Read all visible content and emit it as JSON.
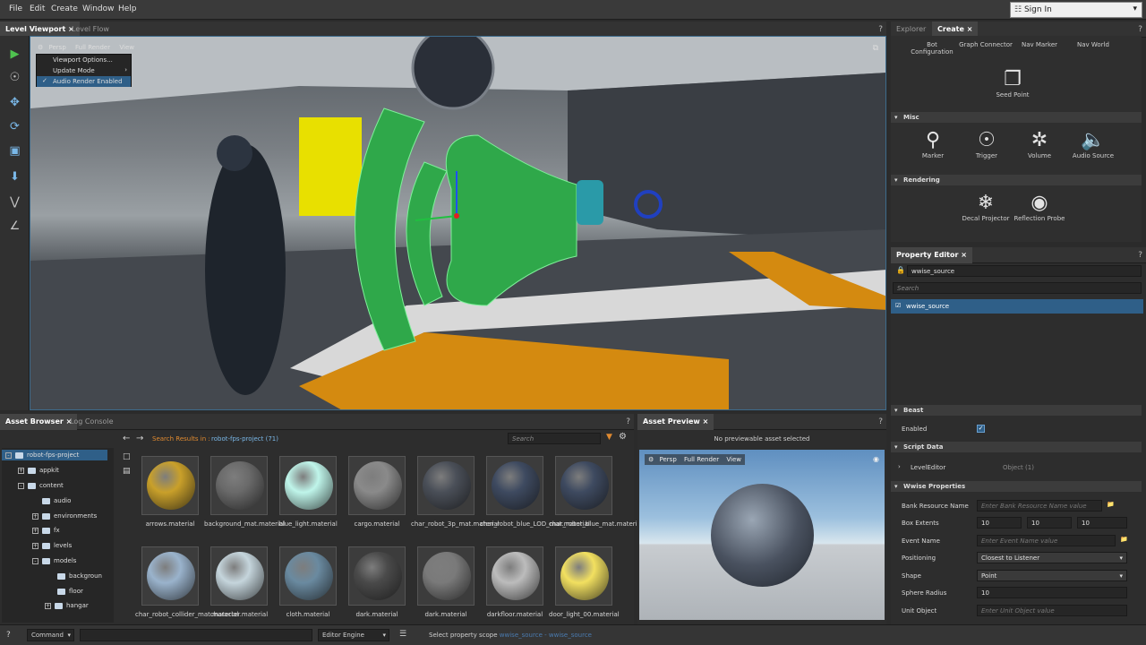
{
  "menu": [
    "File",
    "Edit",
    "Create",
    "Window",
    "Help"
  ],
  "signin": {
    "label": "Sign In"
  },
  "viewport_tabs": [
    "Level Viewport",
    "Level Flow"
  ],
  "viewport_toolbar": {
    "persp": "Persp",
    "render": "Full Render",
    "view": "View"
  },
  "viewport_menu": [
    "Viewport Options...",
    "Update Mode",
    "Audio Render Enabled"
  ],
  "right_tabs": [
    "Explorer",
    "Create"
  ],
  "create": {
    "top_items": [
      "Bot Configuration",
      "Graph Connector",
      "Nav Marker",
      "Nav World"
    ],
    "seed": "Seed Point",
    "misc_label": "Misc",
    "misc_items": [
      "Marker",
      "Trigger",
      "Volume",
      "Audio Source"
    ],
    "rendering_label": "Rendering",
    "rendering_items": [
      "Decal Projector",
      "Reflection Probe"
    ]
  },
  "property_editor": {
    "tab": "Property Editor",
    "object_name": "wwise_source",
    "search_placeholder": "Search",
    "selected": "wwise_source",
    "beast_label": "Beast",
    "enabled_label": "Enabled",
    "script_data_label": "Script Data",
    "level_editor_label": "LevelEditor",
    "level_editor_value": "Object (1)",
    "wwise_label": "Wwise Properties",
    "fields": {
      "bank": {
        "label": "Bank Resource Name",
        "placeholder": "Enter Bank Resource Name value"
      },
      "box": {
        "label": "Box Extents",
        "values": [
          "10",
          "10",
          "10"
        ]
      },
      "event": {
        "label": "Event Name",
        "placeholder": "Enter Event Name value"
      },
      "positioning": {
        "label": "Positioning",
        "value": "Closest to Listener"
      },
      "shape": {
        "label": "Shape",
        "value": "Point"
      },
      "radius": {
        "label": "Sphere Radius",
        "value": "10"
      },
      "unit": {
        "label": "Unit Object",
        "placeholder": "Enter Unit Object value"
      }
    }
  },
  "asset_browser": {
    "tabs": [
      "Asset Browser",
      "Log Console"
    ],
    "search_prefix": "Search Results in :",
    "search_scope": "robot-fps-project (71)",
    "search_placeholder": "Search",
    "tree": [
      "robot-fps-project",
      "appkit",
      "content",
      "audio",
      "environments",
      "fx",
      "levels",
      "models",
      "backgroun",
      "floor",
      "hangar"
    ],
    "materials": [
      {
        "name": "arrows.material",
        "color": "#c9a02a"
      },
      {
        "name": "background_mat.material",
        "color": "#6a6a6a"
      },
      {
        "name": "blue_light.material",
        "color": "#bff5ea"
      },
      {
        "name": "cargo.material",
        "color": "#8a8a8a"
      },
      {
        "name": "char_robot_3p_mat.material",
        "color": "#4a4f58"
      },
      {
        "name": "char_robot_blue_LOD_mat.material",
        "color": "#3e4a60"
      },
      {
        "name": "char_robot_blue_mat.material",
        "color": "#3e4a60"
      },
      {
        "name": "char_robot_collider_mat.material",
        "color": "#9ab3cc"
      },
      {
        "name": "character.material",
        "color": "#c5d5dc"
      },
      {
        "name": "cloth.material",
        "color": "#6a8aa0"
      },
      {
        "name": "dark.material",
        "color": "#4a4a4a"
      },
      {
        "name": "dark.material",
        "color": "#7a7a7a"
      },
      {
        "name": "darkfloor.material",
        "color": "#bcbcbc"
      },
      {
        "name": "door_light_00.material",
        "color": "#f2e060"
      }
    ]
  },
  "asset_preview": {
    "tab": "Asset Preview",
    "message": "No previewable asset selected",
    "persp": "Persp",
    "render": "Full Render",
    "view": "View"
  },
  "status": {
    "command": "Command",
    "engine": "Editor Engine",
    "message": "Select property scope",
    "scope1": "wwise_source",
    "scope2": "wwise_source"
  }
}
